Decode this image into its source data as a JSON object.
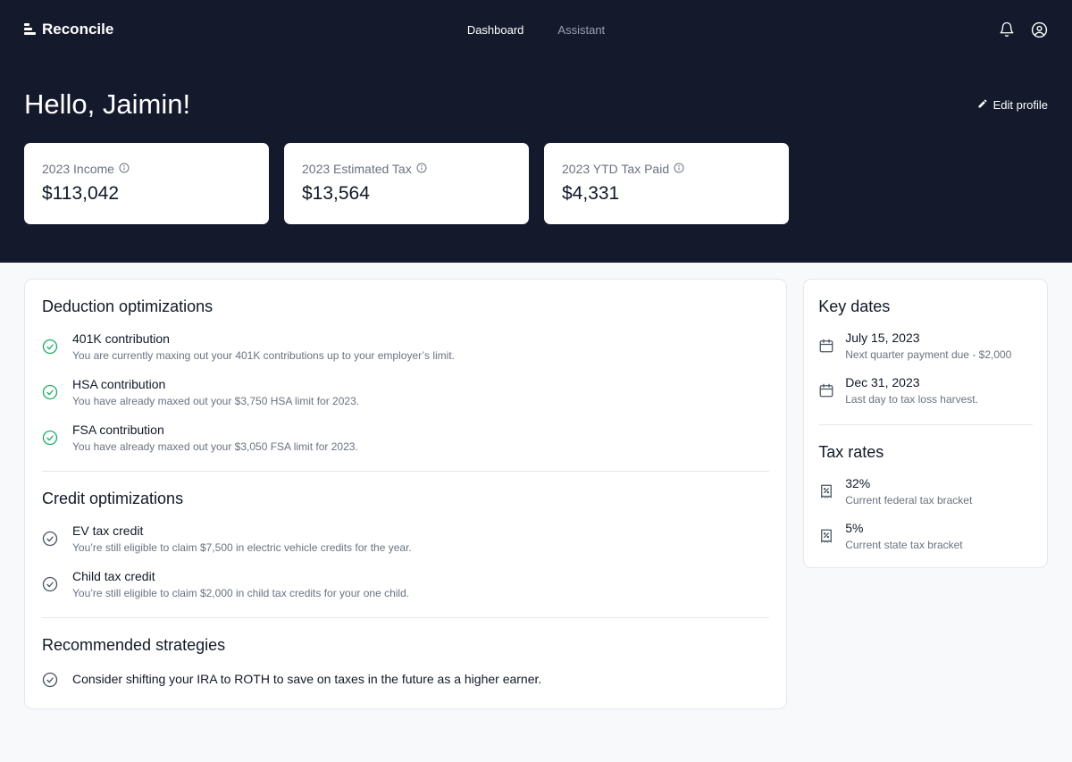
{
  "app": {
    "name": "Reconcile"
  },
  "nav": {
    "items": [
      {
        "label": "Dashboard",
        "active": true
      },
      {
        "label": "Assistant",
        "active": false
      }
    ]
  },
  "header": {
    "greeting": "Hello, Jaimin!",
    "edit_profile_label": "Edit profile"
  },
  "stats": [
    {
      "label": "2023 Income",
      "value": "$113,042"
    },
    {
      "label": "2023 Estimated Tax",
      "value": "$13,564"
    },
    {
      "label": "2023 YTD Tax Paid",
      "value": "$4,331"
    }
  ],
  "deductions": {
    "title": "Deduction optimizations",
    "items": [
      {
        "title": "401K contribution",
        "desc": "You are currently maxing out your 401K contributions up to your employer’s limit."
      },
      {
        "title": "HSA contribution",
        "desc": "You have already maxed out your $3,750 HSA limit for 2023."
      },
      {
        "title": "FSA contribution",
        "desc": "You have already maxed out your $3,050 FSA limit for 2023."
      }
    ]
  },
  "credits": {
    "title": "Credit optimizations",
    "items": [
      {
        "title": "EV tax credit",
        "desc": "You’re still eligible to claim $7,500 in electric vehicle credits for the year."
      },
      {
        "title": "Child tax credit",
        "desc": "You’re still eligible to claim $2,000 in child tax credits for your one child."
      }
    ]
  },
  "strategies": {
    "title": "Recommended strategies",
    "items": [
      {
        "text": "Consider shifting your IRA to ROTH to save on taxes in the future as a higher earner."
      }
    ]
  },
  "key_dates": {
    "title": "Key dates",
    "items": [
      {
        "title": "July 15, 2023",
        "desc": "Next quarter payment due - $2,000"
      },
      {
        "title": "Dec 31, 2023",
        "desc": "Last day to tax loss harvest."
      }
    ]
  },
  "tax_rates": {
    "title": "Tax rates",
    "items": [
      {
        "title": "32%",
        "desc": "Current federal tax bracket"
      },
      {
        "title": "5%",
        "desc": "Current state tax bracket"
      }
    ]
  },
  "colors": {
    "header_bg": "#141a2c",
    "page_bg": "#f8f9fb",
    "success_green": "#1fae6b",
    "muted_gray": "#6b7280"
  },
  "icons": {
    "brand": "logo-stack-icon",
    "notifications": "bell-icon",
    "account": "user-circle-icon",
    "edit": "pencil-icon",
    "info": "info-icon",
    "completed": "check-circle-green-icon",
    "pending": "check-circle-gray-icon",
    "date": "calendar-icon",
    "rate": "receipt-percent-icon"
  }
}
